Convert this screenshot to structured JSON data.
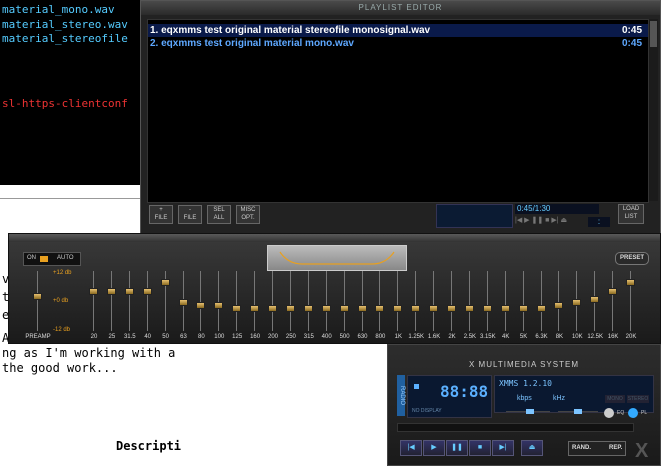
{
  "terminal": {
    "lines": [
      "material_mono.wav",
      "material_stereo.wav",
      "material_stereofile",
      "sl-https-clientconf"
    ]
  },
  "document": {
    "lines": [
      "vo",
      "t",
      "e",
      "A",
      "ng as I'm working with a",
      " the good work...",
      "Descripti"
    ]
  },
  "playlist": {
    "title": "PLAYLIST EDITOR",
    "items": [
      {
        "text": "1. eqxmms test original material stereofile monosignal.wav",
        "duration": "0:45"
      },
      {
        "text": "2. eqxmms test original material mono.wav",
        "duration": "0:45"
      }
    ],
    "buttons": [
      {
        "top": "+",
        "bottom": "FILE"
      },
      {
        "top": "-",
        "bottom": "FILE"
      },
      {
        "top": "SEL",
        "bottom": "ALL"
      },
      {
        "top": "MISC",
        "bottom": "OPT."
      }
    ],
    "time": "0:45/1:30",
    "time_colon": ":",
    "load_list": {
      "top": "LOAD",
      "bottom": "LIST"
    }
  },
  "equalizer": {
    "on_label": "ON",
    "auto_label": "AUTO",
    "preset_label": "PRESET",
    "db_labels": [
      "+12 db",
      "+0 db",
      "-12 db"
    ],
    "preamp_label": "PREAMP",
    "preamp_level": 0.4,
    "bands": [
      {
        "label": "20",
        "level": 0.3
      },
      {
        "label": "25",
        "level": 0.3
      },
      {
        "label": "31.5",
        "level": 0.3
      },
      {
        "label": "40",
        "level": 0.3
      },
      {
        "label": "50",
        "level": 0.15
      },
      {
        "label": "63",
        "level": 0.5
      },
      {
        "label": "80",
        "level": 0.55
      },
      {
        "label": "100",
        "level": 0.55
      },
      {
        "label": "125",
        "level": 0.6
      },
      {
        "label": "160",
        "level": 0.6
      },
      {
        "label": "200",
        "level": 0.6
      },
      {
        "label": "250",
        "level": 0.6
      },
      {
        "label": "315",
        "level": 0.6
      },
      {
        "label": "400",
        "level": 0.6
      },
      {
        "label": "500",
        "level": 0.6
      },
      {
        "label": "630",
        "level": 0.6
      },
      {
        "label": "800",
        "level": 0.6
      },
      {
        "label": "1K",
        "level": 0.6
      },
      {
        "label": "1.25K",
        "level": 0.6
      },
      {
        "label": "1.6K",
        "level": 0.6
      },
      {
        "label": "2K",
        "level": 0.6
      },
      {
        "label": "2.5K",
        "level": 0.6
      },
      {
        "label": "3.15K",
        "level": 0.6
      },
      {
        "label": "4K",
        "level": 0.6
      },
      {
        "label": "5K",
        "level": 0.6
      },
      {
        "label": "6.3K",
        "level": 0.6
      },
      {
        "label": "8K",
        "level": 0.55
      },
      {
        "label": "10K",
        "level": 0.5
      },
      {
        "label": "12.5K",
        "level": 0.45
      },
      {
        "label": "16K",
        "level": 0.3
      },
      {
        "label": "20K",
        "level": 0.15
      }
    ]
  },
  "player": {
    "title": "X MULTIMEDIA SYSTEM",
    "side_label": "RADIO",
    "display_label": "NO DISPLAY",
    "time_digits": "88:88",
    "song_title": "XMMS 1.2.10",
    "kbps_label": "kbps",
    "khz_label": "kHz",
    "mono_label": "MONO",
    "stereo_label": "STEREO",
    "eq_label": "EQ",
    "pl_label": "PL",
    "controls": [
      "prev",
      "play",
      "pause",
      "stop",
      "next",
      "eject"
    ],
    "random_label": "RAND.",
    "repeat_label": "REP.",
    "logo": "X",
    "colors": {
      "accent": "#5bb0ff",
      "eq_knob": "#e8a020",
      "playlist_current": "#ffffff",
      "playlist_other": "#5ea8ff"
    }
  }
}
